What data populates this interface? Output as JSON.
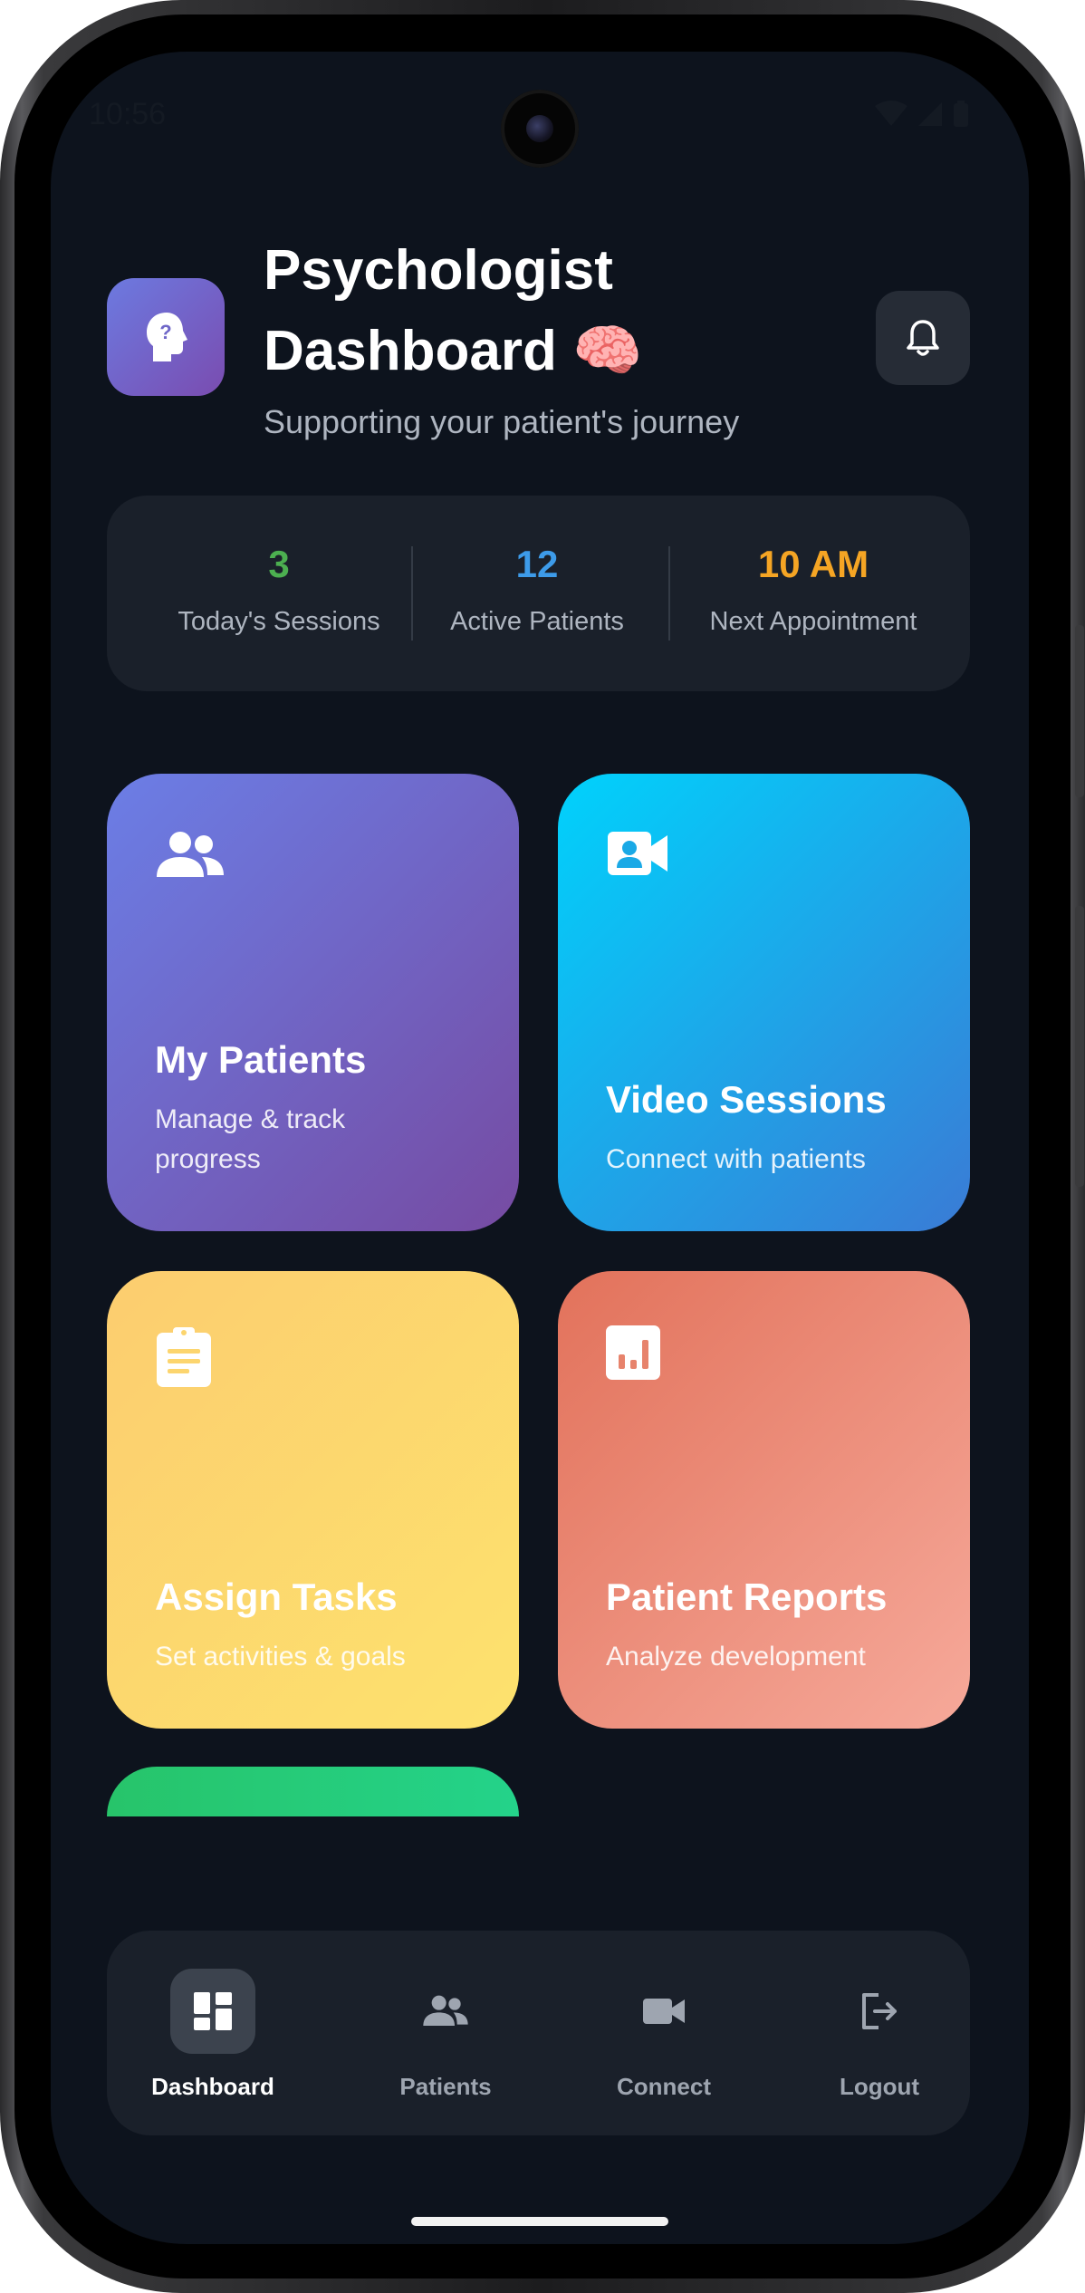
{
  "status_bar": {
    "time": "10:56"
  },
  "header": {
    "title": "Psychologist Dashboard 🧠",
    "subtitle": "Supporting your patient's journey"
  },
  "stats": [
    {
      "value": "3",
      "label": "Today's Sessions",
      "color": "#4caf50"
    },
    {
      "value": "12",
      "label": "Active Patients",
      "color": "#3d9be9"
    },
    {
      "value": "10 AM",
      "label": "Next Appointment",
      "color": "#f5a524"
    }
  ],
  "cards": [
    {
      "title": "My Patients",
      "description": "Manage & track progress",
      "icon": "people-icon",
      "gradient": [
        "#6b7ee6",
        "#764ba2"
      ]
    },
    {
      "title": "Video Sessions",
      "description": "Connect with patients",
      "icon": "video-icon",
      "gradient": [
        "#00d2fc",
        "#3a7bd5"
      ]
    },
    {
      "title": "Assign Tasks",
      "description": "Set activities & goals",
      "icon": "clipboard-icon",
      "gradient": [
        "#fccd6f",
        "#fde26e"
      ]
    },
    {
      "title": "Patient Reports",
      "description": "Analyze development",
      "icon": "chart-icon",
      "gradient": [
        "#e2725b",
        "#f6a99a"
      ]
    }
  ],
  "bottom_nav": [
    {
      "label": "Dashboard",
      "icon": "dashboard-icon",
      "active": true
    },
    {
      "label": "Patients",
      "icon": "people-icon",
      "active": false
    },
    {
      "label": "Connect",
      "icon": "video-camera-icon",
      "active": false
    },
    {
      "label": "Logout",
      "icon": "logout-icon",
      "active": false
    }
  ]
}
